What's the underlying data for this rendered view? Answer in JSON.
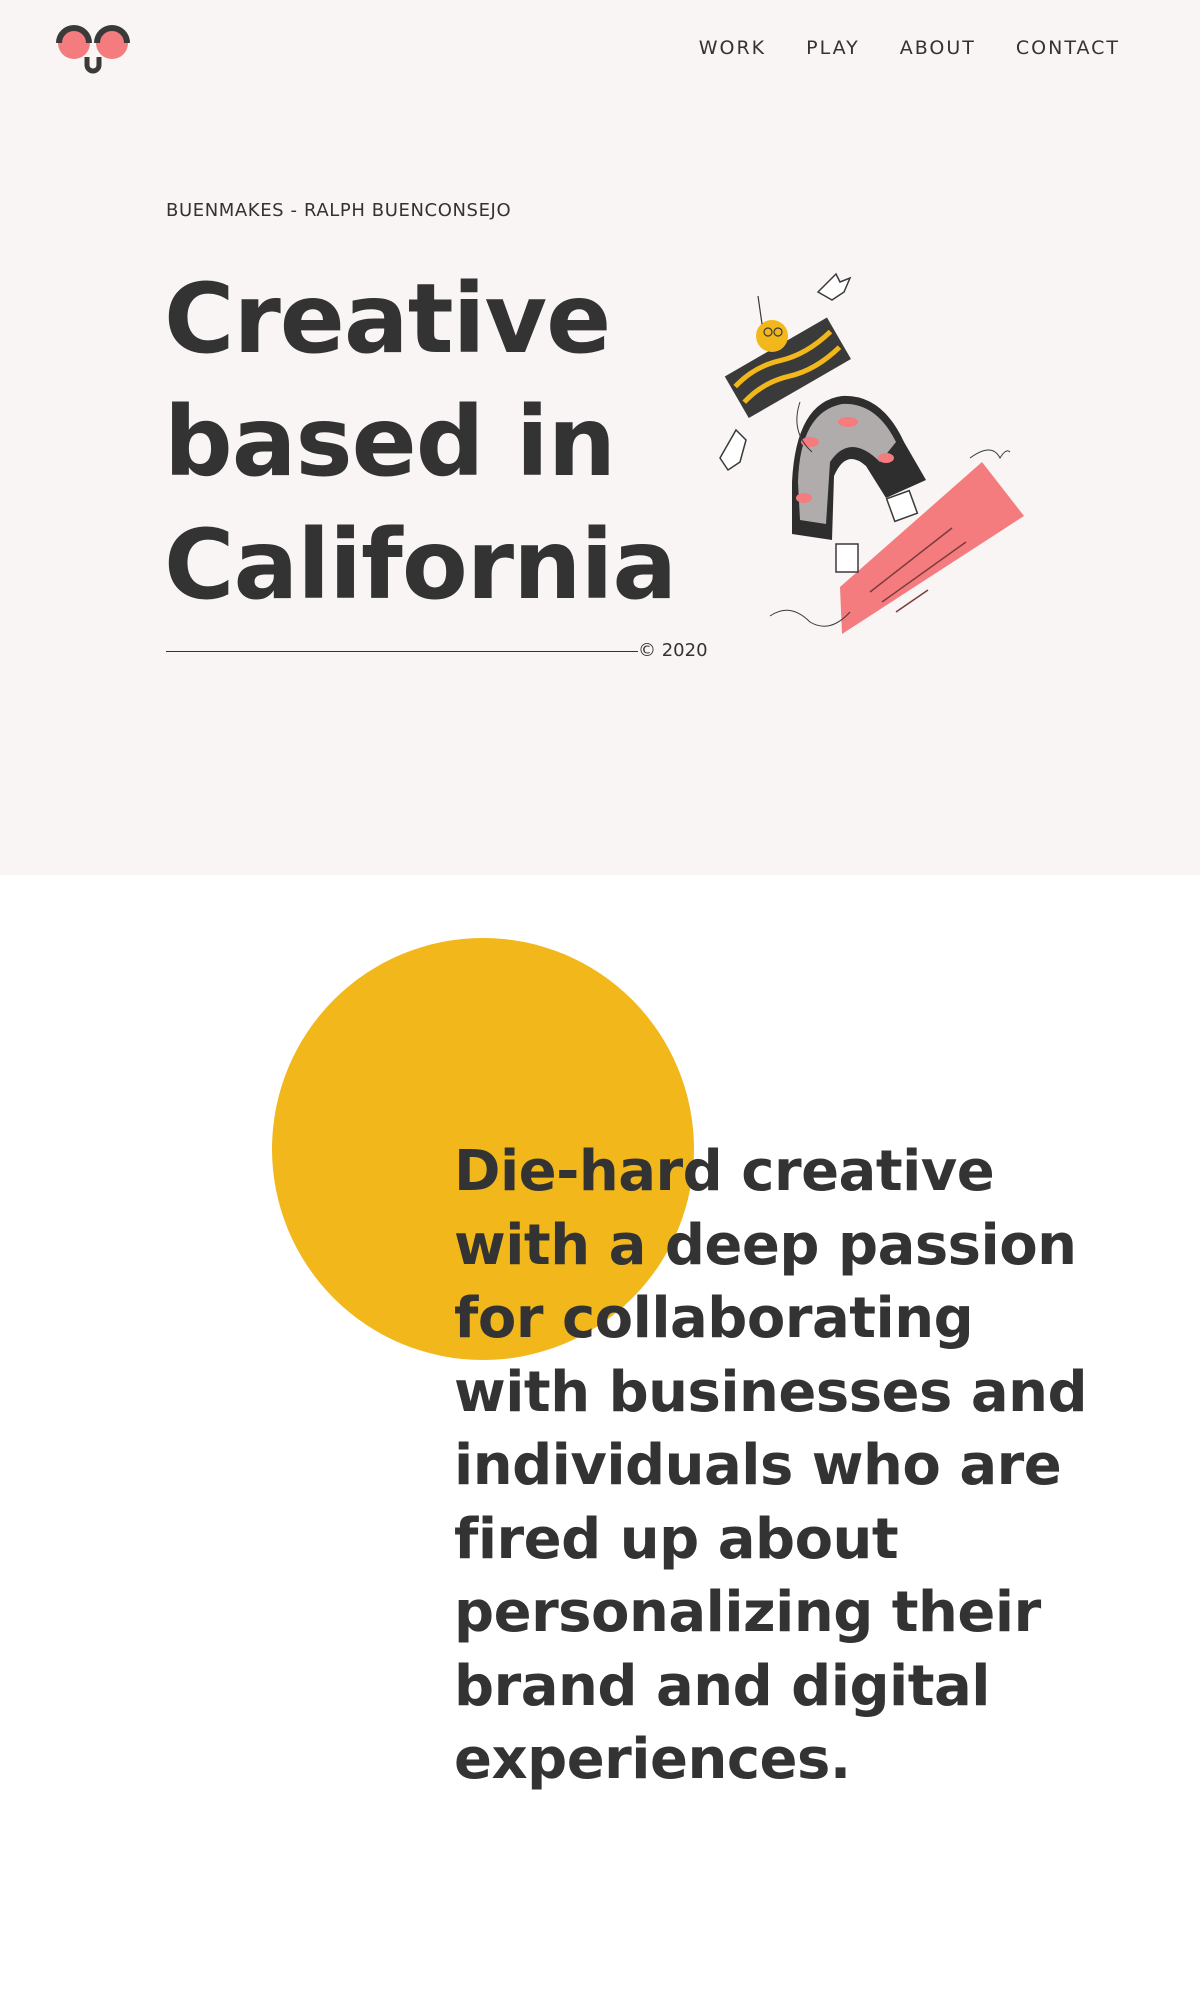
{
  "nav": {
    "items": [
      {
        "label": "WORK"
      },
      {
        "label": "PLAY"
      },
      {
        "label": "ABOUT"
      },
      {
        "label": "CONTACT"
      }
    ]
  },
  "hero": {
    "eyebrow": "BUENMAKES - RALPH BUENCONSEJO",
    "title_lines": [
      "Creative",
      "based in",
      "California"
    ],
    "copyright": "© 2020"
  },
  "about": {
    "text": "Die-hard creative with a deep passion for collaborating with businesses and individuals who are fired up about personalizing their brand and digital experiences."
  },
  "colors": {
    "hero_background": "#f9f5f4",
    "text": "#333333",
    "accent_yellow": "#f2b71b",
    "accent_pink": "#f47b7e"
  },
  "icons": {
    "logo": "smiley-face-logo-icon",
    "illustration": "falling-person-illustration"
  }
}
